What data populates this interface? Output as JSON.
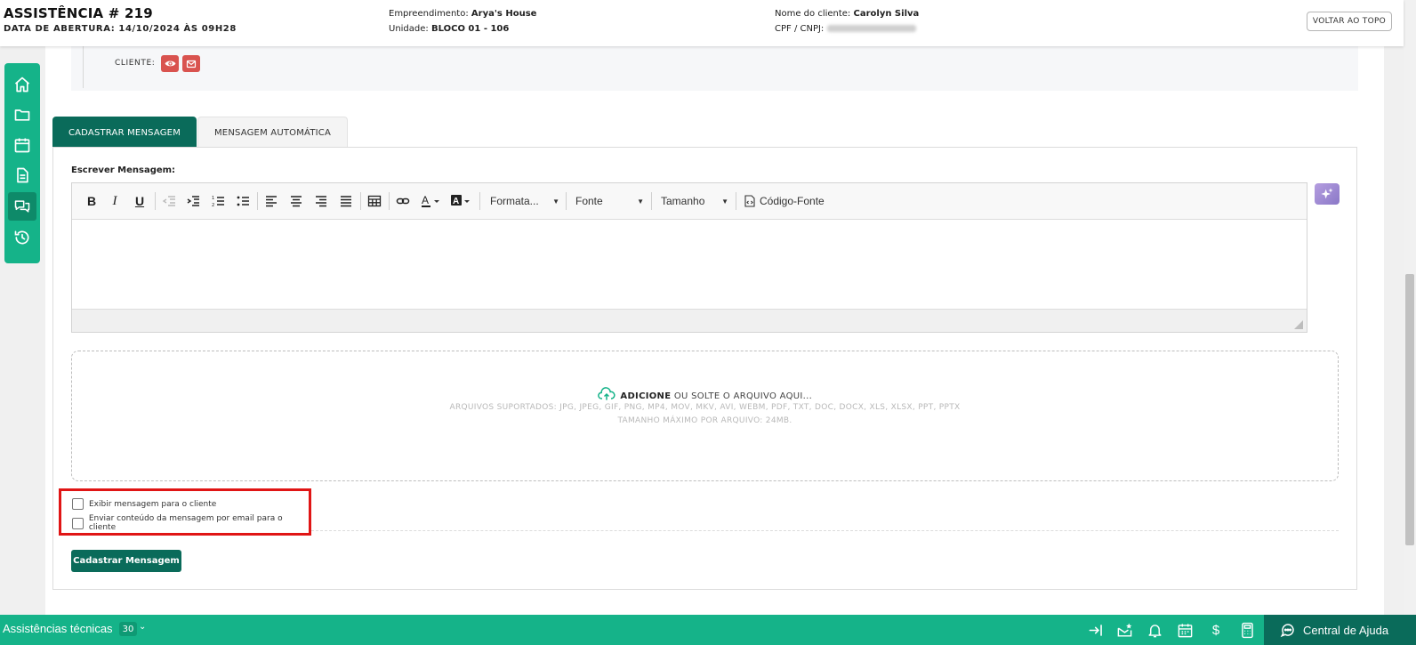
{
  "header": {
    "title": "ASSISTÊNCIA # 219",
    "opening_date": "DATA DE ABERTURA: 14/10/2024 ÀS 09H28",
    "empreendimento_label": "Empreendimento:",
    "empreendimento_value": "Arya's House",
    "unidade_label": "Unidade:",
    "unidade_value": "BLOCO 01 - 106",
    "cliente_label": "Nome do cliente:",
    "cliente_value": "Carolyn Silva",
    "cpf_label": "CPF / CNPJ:",
    "back_to_top": "VOLTAR AO TOPO"
  },
  "sidebar": {
    "items": [
      {
        "icon": "home-icon"
      },
      {
        "icon": "folder-icon"
      },
      {
        "icon": "calendar-icon"
      },
      {
        "icon": "document-icon"
      },
      {
        "icon": "chat-icon",
        "active": true
      },
      {
        "icon": "history-icon"
      }
    ]
  },
  "client": {
    "label": "CLIENTE:"
  },
  "tabs": [
    {
      "label": "CADASTRAR MENSAGEM",
      "active": true
    },
    {
      "label": "MENSAGEM AUTOMÁTICA",
      "active": false
    }
  ],
  "form": {
    "write_label": "Escrever Mensagem:",
    "toolbar": {
      "bold": "B",
      "italic": "I",
      "underline": "U",
      "format": "Formata...",
      "font": "Fonte",
      "size": "Tamanho",
      "source": "Código-Fonte"
    },
    "upload": {
      "add": "ADICIONE",
      "drop_text": "OU SOLTE O ARQUIVO AQUI...",
      "supported": "ARQUIVOS SUPORTADOS: JPG, JPEG, GIF, PNG, MP4, MOV, MKV, AVI, WEBM, PDF, TXT, DOC, DOCX, XLS, XLSX, PPT, PPTX",
      "max_size": "TAMANHO MÁXIMO POR ARQUIVO: 24MB."
    },
    "checkbox_show": "Exibir mensagem para o cliente",
    "checkbox_email": "Enviar conteúdo da mensagem por email para o cliente",
    "submit": "Cadastrar Mensagem"
  },
  "footer": {
    "label": "Assistências técnicas",
    "count": "30",
    "currency": "$",
    "help": "Central de Ajuda"
  },
  "colors": {
    "brand_green": "#15b389",
    "dark_green": "#0a6b5a",
    "danger": "#d9534f",
    "highlight": "#e01515"
  }
}
